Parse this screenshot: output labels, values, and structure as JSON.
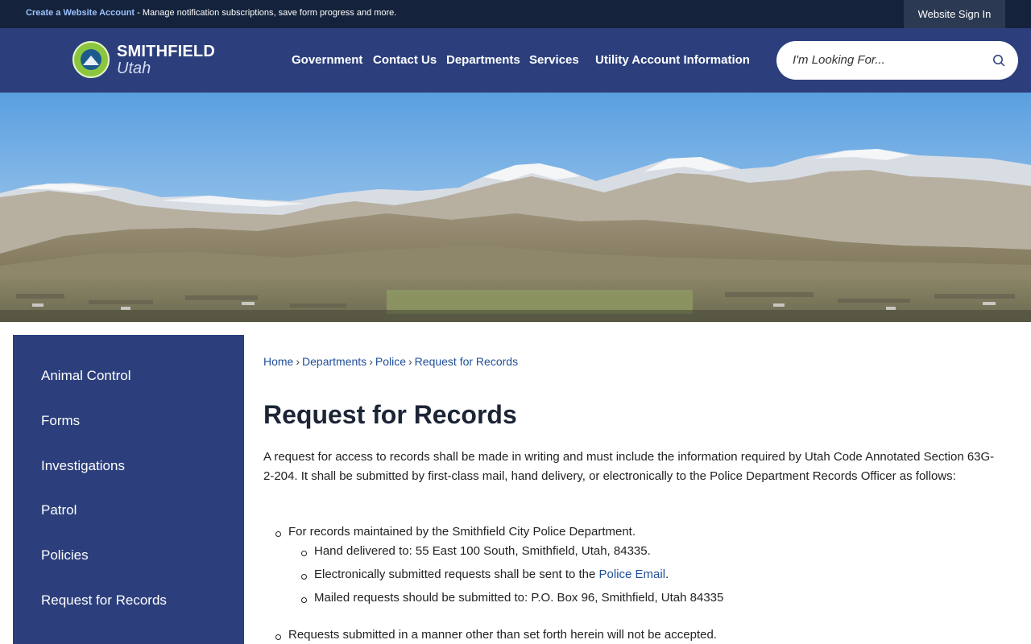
{
  "topbar": {
    "account_link": "Create a Website Account",
    "account_desc": " - Manage notification subscriptions, save form progress and more.",
    "sign_in": "Website Sign In"
  },
  "logo": {
    "line1": "SMITHFIELD",
    "line2": "Utah"
  },
  "nav": {
    "items": [
      "Government",
      "Contact Us",
      "Departments",
      "Services",
      "Utility Account Information"
    ]
  },
  "search": {
    "placeholder": "I'm Looking For...",
    "icon": "search-icon"
  },
  "sidebar": {
    "items": [
      "Animal Control",
      "Forms",
      "Investigations",
      "Patrol",
      "Policies",
      "Request for Records"
    ]
  },
  "breadcrumb": [
    "Home",
    "Departments",
    "Police",
    "Request for Records"
  ],
  "page": {
    "title": "Request for Records",
    "intro": "A request for access to records shall be made in writing and must include the information required by Utah Code Annotated Section 63G-2-204. It shall be submitted by first-class mail, hand delivery, or electronically to the Police Department Records Officer as follows:",
    "bullet1": "For records maintained by the Smithfield City Police Department.",
    "sub1": "Hand delivered to: 55 East 100 South, Smithfield, Utah, 84335.",
    "sub2_prefix": "Electronically submitted requests shall be sent to the ",
    "sub2_link": "Police Email",
    "sub2_suffix": ".",
    "sub3": "Mailed requests should be submitted to: P.O. Box 96, Smithfield, Utah 84335",
    "bullet2": "Requests submitted in a manner other than set forth herein will not be accepted."
  },
  "colors": {
    "header_bg": "#2c3f7c",
    "topbar_bg": "#14233b",
    "link": "#1f4e99"
  }
}
